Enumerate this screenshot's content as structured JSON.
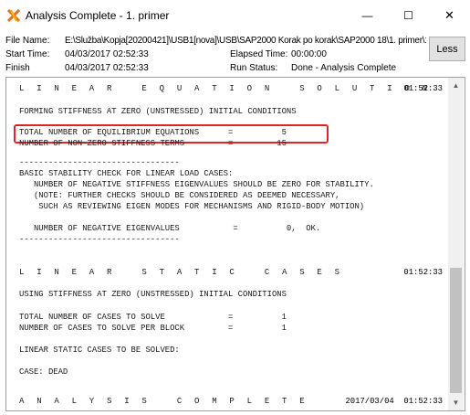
{
  "window": {
    "title": "Analysis Complete - 1. primer",
    "icon": "sap2000-app-icon",
    "controls": {
      "minimize": "—",
      "maximize": "☐",
      "close": "✕"
    }
  },
  "info": {
    "file_name_label": "File Name:",
    "file_name_value": "E:\\Služba\\Kopja[20200421]\\USB1[nova]\\USB\\SAP2000 Korak po korak\\SAP2000 18\\1. primer\\1. pri",
    "start_time_label": "Start Time:",
    "start_time_value": "04/03/2017 02:52:33",
    "elapsed_time_label": "Elapsed Time:",
    "elapsed_time_value": "00:00:00",
    "finish_label": "Finish",
    "finish_value": "04/03/2017 02:52:33",
    "run_status_label": "Run Status:",
    "run_status_value": "Done - Analysis Complete",
    "less_button": "Less"
  },
  "console": {
    "linear_equation_heading": "L I N E A R   E Q U A T I O N   S O L U T I O N",
    "linear_equation_time": "01:52:33",
    "forming_stiffness": "FORMING STIFFNESS AT ZERO (UNSTRESSED) INITIAL CONDITIONS",
    "total_equations": "TOTAL NUMBER OF EQUILIBRIUM EQUATIONS      =          5",
    "nonzero_terms": "NUMBER OF NON-ZERO STIFFNESS TERMS         =         15",
    "divider_1": "---------------------------------",
    "stability_title": "BASIC STABILITY CHECK FOR LINEAR LOAD CASES:",
    "stability_line1": "   NUMBER OF NEGATIVE STIFFNESS EIGENVALUES SHOULD BE ZERO FOR STABILITY.",
    "stability_line2": "   (NOTE: FURTHER CHECKS SHOULD BE CONSIDERED AS DEEMED NECESSARY,",
    "stability_line3": "    SUCH AS REVIEWING EIGEN MODES FOR MECHANISMS AND RIGID-BODY MOTION)",
    "negative_eigen": "   NUMBER OF NEGATIVE EIGENVALUES           =          0,  OK.",
    "divider_2": "---------------------------------",
    "linear_static_heading": "L I N E A R   S T A T I C   C A S E S",
    "linear_static_time": "01:52:33",
    "using_stiffness": "USING STIFFNESS AT ZERO (UNSTRESSED) INITIAL CONDITIONS",
    "cases_to_solve": "TOTAL NUMBER OF CASES TO SOLVE             =          1",
    "cases_per_block": "NUMBER OF CASES TO SOLVE PER BLOCK         =          1",
    "cases_to_be_solved": "LINEAR STATIC CASES TO BE SOLVED:",
    "case_dead": "CASE: DEAD",
    "analysis_complete_heading": "A N A L Y S I S   C O M P L E T E",
    "analysis_complete_time": "2017/03/04  01:52:33"
  },
  "scroll": {
    "up": "▲",
    "down": "▼"
  },
  "colors": {
    "highlight": "#e0242a",
    "scroll_thumb": "#c1c1c1"
  }
}
